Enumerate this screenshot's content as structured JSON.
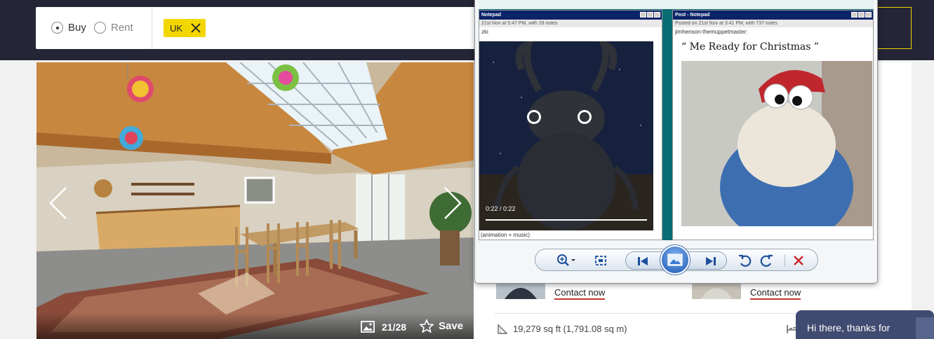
{
  "search": {
    "buy_label": "Buy",
    "rent_label": "Rent",
    "selected": "buy",
    "location_chip": "UK"
  },
  "gallery": {
    "counter": "21/28",
    "save_label": "Save"
  },
  "listing": {
    "agents": [
      {
        "contact_label": "Contact now"
      },
      {
        "contact_label": "Contact now"
      }
    ],
    "area": "19,279 sq ft (1,791.08 sq m)"
  },
  "viewer": {
    "left_window": {
      "title": "Notepad",
      "meta": "21st Nov at 5:47 PM, with 28 notes",
      "user": "zki",
      "video_time": "0:22 / 0:22",
      "caption": "(animation + music)"
    },
    "right_window": {
      "title": "Post - Notepad",
      "meta": "Posted on 21st Nov at 3:41 PM, with 737 notes",
      "user": "jimhenson-themuppetmaster:",
      "quote": "“ Me Ready for Christmas ”"
    }
  },
  "chat": {
    "greeting": "Hi there, thanks for"
  },
  "colors": {
    "header_bg": "#242536",
    "chip_yellow": "#f2d600",
    "contact_underline": "#c0392b",
    "chat_bg": "#3f4b70"
  }
}
